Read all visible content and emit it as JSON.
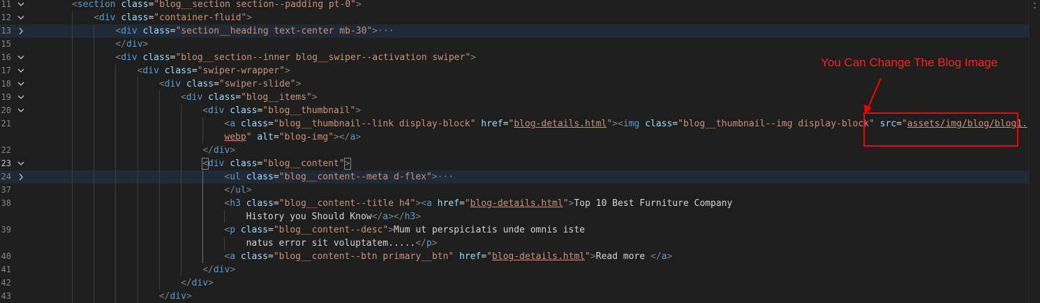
{
  "annotation": {
    "label": "You Can Change The Blog Image",
    "color": "#ff0000"
  },
  "lines": [
    {
      "num": "11",
      "fold": "down",
      "segs": [
        [
          "t",
          "<"
        ],
        [
          "tag",
          "section"
        ],
        [
          "txt",
          " "
        ],
        [
          "attr",
          "class"
        ],
        [
          "txt",
          "="
        ],
        [
          "str",
          "\"blog__section section--padding pt-0\""
        ],
        [
          "t",
          ">"
        ]
      ]
    },
    {
      "num": "12",
      "fold": "down",
      "segs": [
        [
          "t",
          "<"
        ],
        [
          "tag",
          "div"
        ],
        [
          "txt",
          " "
        ],
        [
          "attr",
          "class"
        ],
        [
          "txt",
          "="
        ],
        [
          "str",
          "\"container-fluid\""
        ],
        [
          "t",
          ">"
        ]
      ]
    },
    {
      "num": "13",
      "fold": "right",
      "highlight": true,
      "segs": [
        [
          "t",
          "<"
        ],
        [
          "tag",
          "div"
        ],
        [
          "txt",
          " "
        ],
        [
          "attr",
          "class"
        ],
        [
          "txt",
          "="
        ],
        [
          "str",
          "\"section__heading text-center mb-30\""
        ],
        [
          "t",
          ">"
        ],
        [
          "ell",
          "···"
        ]
      ]
    },
    {
      "num": "15",
      "fold": "",
      "segs": [
        [
          "t",
          "</"
        ],
        [
          "tag",
          "div"
        ],
        [
          "t",
          ">"
        ]
      ]
    },
    {
      "num": "16",
      "fold": "down",
      "segs": [
        [
          "t",
          "<"
        ],
        [
          "tag",
          "div"
        ],
        [
          "txt",
          " "
        ],
        [
          "attr",
          "class"
        ],
        [
          "txt",
          "="
        ],
        [
          "str",
          "\"blog__section--inner blog__swiper--activation swiper\""
        ],
        [
          "t",
          ">"
        ]
      ]
    },
    {
      "num": "17",
      "fold": "down",
      "segs": [
        [
          "t",
          "<"
        ],
        [
          "tag",
          "div"
        ],
        [
          "txt",
          " "
        ],
        [
          "attr",
          "class"
        ],
        [
          "txt",
          "="
        ],
        [
          "str",
          "\"swiper-wrapper\""
        ],
        [
          "t",
          ">"
        ]
      ]
    },
    {
      "num": "18",
      "fold": "down",
      "segs": [
        [
          "t",
          "<"
        ],
        [
          "tag",
          "div"
        ],
        [
          "txt",
          " "
        ],
        [
          "attr",
          "class"
        ],
        [
          "txt",
          "="
        ],
        [
          "str",
          "\"swiper-slide\""
        ],
        [
          "t",
          ">"
        ]
      ]
    },
    {
      "num": "19",
      "fold": "down",
      "segs": [
        [
          "t",
          "<"
        ],
        [
          "tag",
          "div"
        ],
        [
          "txt",
          " "
        ],
        [
          "attr",
          "class"
        ],
        [
          "txt",
          "="
        ],
        [
          "str",
          "\"blog__items\""
        ],
        [
          "t",
          ">"
        ]
      ]
    },
    {
      "num": "20",
      "fold": "down",
      "segs": [
        [
          "t",
          "<"
        ],
        [
          "tag",
          "div"
        ],
        [
          "txt",
          " "
        ],
        [
          "attr",
          "class"
        ],
        [
          "txt",
          "="
        ],
        [
          "str",
          "\"blog__thumbnail\""
        ],
        [
          "t",
          ">"
        ]
      ]
    },
    {
      "num": "21",
      "fold": "",
      "segs": [
        [
          "t",
          "<"
        ],
        [
          "tag",
          "a"
        ],
        [
          "txt",
          " "
        ],
        [
          "attr",
          "class"
        ],
        [
          "txt",
          "="
        ],
        [
          "str",
          "\"blog__thumbnail--link display-block\""
        ],
        [
          "txt",
          " "
        ],
        [
          "attr",
          "href"
        ],
        [
          "txt",
          "="
        ],
        [
          "str",
          "\""
        ],
        [
          "strl",
          "blog-details.html"
        ],
        [
          "str",
          "\""
        ],
        [
          "t",
          ">"
        ],
        [
          "t",
          "<"
        ],
        [
          "tag",
          "img"
        ],
        [
          "txt",
          " "
        ],
        [
          "attr",
          "class"
        ],
        [
          "txt",
          "="
        ],
        [
          "str",
          "\"blog__thumbnail--img display-block\""
        ],
        [
          "txt",
          " "
        ],
        [
          "attr",
          "src"
        ],
        [
          "txt",
          "="
        ],
        [
          "str",
          "\""
        ],
        [
          "strl",
          "assets/img/blog/blog1."
        ]
      ]
    },
    {
      "num": "",
      "fold": "",
      "segs": [
        [
          "strl",
          "webp"
        ],
        [
          "str",
          "\""
        ],
        [
          "txt",
          " "
        ],
        [
          "attr",
          "alt"
        ],
        [
          "txt",
          "="
        ],
        [
          "str",
          "\"blog-img\""
        ],
        [
          "t",
          ">"
        ],
        [
          "t",
          "</"
        ],
        [
          "tag",
          "a"
        ],
        [
          "t",
          ">"
        ]
      ]
    },
    {
      "num": "22",
      "fold": "",
      "segs": [
        [
          "t",
          "</"
        ],
        [
          "tag",
          "div"
        ],
        [
          "t",
          ">"
        ]
      ]
    },
    {
      "num": "23",
      "fold": "down",
      "active": true,
      "segs": [
        [
          "tb",
          "<"
        ],
        [
          "tag",
          "div"
        ],
        [
          "txt",
          " "
        ],
        [
          "attr",
          "class"
        ],
        [
          "txt",
          "="
        ],
        [
          "str",
          "\"blog__content\""
        ],
        [
          "tb",
          ">"
        ]
      ]
    },
    {
      "num": "24",
      "fold": "right",
      "highlight": true,
      "segs": [
        [
          "t",
          "<"
        ],
        [
          "tag",
          "ul"
        ],
        [
          "txt",
          " "
        ],
        [
          "attr",
          "class"
        ],
        [
          "txt",
          "="
        ],
        [
          "str",
          "\"blog__content--meta d-flex\""
        ],
        [
          "t",
          ">"
        ],
        [
          "ell",
          "···"
        ]
      ]
    },
    {
      "num": "37",
      "fold": "",
      "segs": [
        [
          "t",
          "</"
        ],
        [
          "tag",
          "ul"
        ],
        [
          "t",
          ">"
        ]
      ]
    },
    {
      "num": "38",
      "fold": "",
      "segs": [
        [
          "t",
          "<"
        ],
        [
          "tag",
          "h3"
        ],
        [
          "txt",
          " "
        ],
        [
          "attr",
          "class"
        ],
        [
          "txt",
          "="
        ],
        [
          "str",
          "\"blog__content--title h4\""
        ],
        [
          "t",
          ">"
        ],
        [
          "t",
          "<"
        ],
        [
          "tag",
          "a"
        ],
        [
          "txt",
          " "
        ],
        [
          "attr",
          "href"
        ],
        [
          "txt",
          "="
        ],
        [
          "str",
          "\""
        ],
        [
          "strl",
          "blog-details.html"
        ],
        [
          "str",
          "\""
        ],
        [
          "t",
          ">"
        ],
        [
          "txt",
          "Top 10 Best Furniture Company"
        ]
      ]
    },
    {
      "num": "",
      "fold": "",
      "segs": [
        [
          "txt",
          "History you Should Know"
        ],
        [
          "t",
          "</"
        ],
        [
          "tag",
          "a"
        ],
        [
          "t",
          ">"
        ],
        [
          "t",
          "</"
        ],
        [
          "tag",
          "h3"
        ],
        [
          "t",
          ">"
        ]
      ]
    },
    {
      "num": "39",
      "fold": "",
      "segs": [
        [
          "t",
          "<"
        ],
        [
          "tag",
          "p"
        ],
        [
          "txt",
          " "
        ],
        [
          "attr",
          "class"
        ],
        [
          "txt",
          "="
        ],
        [
          "str",
          "\"blog__content--desc\""
        ],
        [
          "t",
          ">"
        ],
        [
          "txt",
          "Mum ut perspiciatis unde omnis iste"
        ]
      ]
    },
    {
      "num": "",
      "fold": "",
      "segs": [
        [
          "txt",
          "natus error sit voluptatem....."
        ],
        [
          "t",
          "</"
        ],
        [
          "tag",
          "p"
        ],
        [
          "t",
          ">"
        ]
      ]
    },
    {
      "num": "40",
      "fold": "",
      "segs": [
        [
          "t",
          "<"
        ],
        [
          "tag",
          "a"
        ],
        [
          "txt",
          " "
        ],
        [
          "attr",
          "class"
        ],
        [
          "txt",
          "="
        ],
        [
          "str",
          "\"blog__content--btn primary__btn\""
        ],
        [
          "txt",
          " "
        ],
        [
          "attr",
          "href"
        ],
        [
          "txt",
          "="
        ],
        [
          "str",
          "\""
        ],
        [
          "strl",
          "blog-details.html"
        ],
        [
          "str",
          "\""
        ],
        [
          "t",
          ">"
        ],
        [
          "txt",
          "Read more "
        ],
        [
          "t",
          "</"
        ],
        [
          "tag",
          "a"
        ],
        [
          "t",
          ">"
        ]
      ]
    },
    {
      "num": "41",
      "fold": "",
      "segs": [
        [
          "t",
          "</"
        ],
        [
          "tag",
          "div"
        ],
        [
          "t",
          ">"
        ]
      ]
    },
    {
      "num": "42",
      "fold": "",
      "segs": [
        [
          "t",
          "</"
        ],
        [
          "tag",
          "div"
        ],
        [
          "t",
          ">"
        ]
      ]
    },
    {
      "num": "43",
      "fold": "",
      "segs": [
        [
          "t",
          "</"
        ],
        [
          "tag",
          "div"
        ],
        [
          "t",
          ">"
        ]
      ]
    }
  ]
}
